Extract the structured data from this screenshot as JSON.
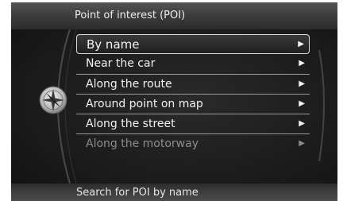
{
  "header": {
    "title": "Point of interest (POI)"
  },
  "menu": {
    "items": [
      {
        "label": "By name",
        "arrow": "▶"
      },
      {
        "label": "Near the car",
        "arrow": "▶"
      },
      {
        "label": "Along the route",
        "arrow": "▶"
      },
      {
        "label": "Around point on map",
        "arrow": "▶"
      },
      {
        "label": "Along the street",
        "arrow": "▶"
      },
      {
        "label": "Along the motorway",
        "arrow": "▶"
      }
    ],
    "selected_index": 0
  },
  "footer": {
    "hint": "Search for POI by name"
  },
  "icons": {
    "left": "compass-icon"
  },
  "colors": {
    "background": "#1c1c1c",
    "header": "#3a3a3a",
    "text": "#f2f2f2",
    "disabled_text": "#8c8c8c",
    "selection_border": "#dcdcdc"
  }
}
